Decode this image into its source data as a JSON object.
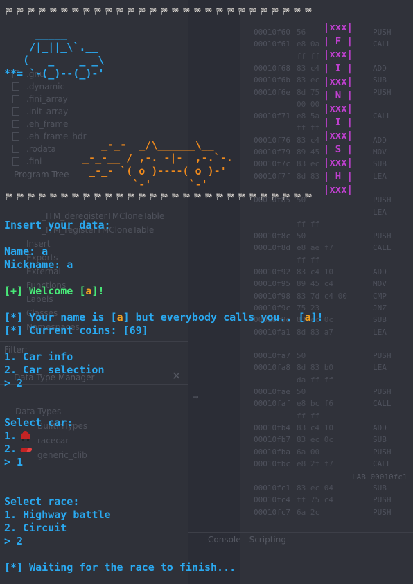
{
  "terminal": {
    "flag_glyph": "🏁",
    "flag_count": 28,
    "car_art_top": "     _____\n    /|_||_\\`.__\n   (   _    _ _\\\n**= `-(_)--(_)-'",
    "car_art_race": "    _-_-  _/\\______\\__\n _-_-__ / ,-. -|-  ,-.`-.\n  _-_- `( o )----( o )-'\n         `-'      `-'",
    "finish_banner": [
      "|xxx|",
      "| F |",
      "|xxx|",
      "| I |",
      "|xxx|",
      "| N |",
      "|xxx|",
      "| I |",
      "|xxx|",
      "| S |",
      "|xxx|",
      "| H |",
      "|xxx|"
    ],
    "insert_prompt": "Insert your data:",
    "name_line": "Name: a",
    "nickname_line": "Nickname: a",
    "welcome": {
      "prefix": "[+] Welcome [",
      "name": "a",
      "suffix": "]!"
    },
    "name_info": {
      "prefix": "[*] Your name is [",
      "name": "a",
      "middle": "] but everybody calls you.. [",
      "nick": "a",
      "suffix": "]!"
    },
    "coins_line": "[*] Current coins: [69]",
    "menu": [
      "1. Car info",
      "2. Car selection"
    ],
    "menu_choice": "> 2",
    "select_car_title": "Select car:",
    "car_options": [
      "1.",
      "2."
    ],
    "car_choice": "> 1",
    "select_race_title": "Select race:",
    "race_options": [
      "1. Highway battle",
      "2. Circuit"
    ],
    "race_choice": "> 2",
    "waiting_line": "[*] Waiting for the race to finish..."
  },
  "background": {
    "tree_items": [
      ".gnu",
      ".dynamic",
      ".fini_array",
      ".init_array",
      ".eh_frame",
      ".eh_frame_hdr",
      ".rodata",
      ".fini"
    ],
    "panel_program_tree": "Program Tree",
    "symbol_items": [
      "_ITM_deregisterTMCloneTable",
      "_ITM_registerTMCloneTable",
      "Insert",
      "Exports",
      "External",
      "Functions",
      "Labels",
      "Classes",
      "Namespaces"
    ],
    "panel_filter": "Filter:",
    "panel_data_type": "Data Type Manager",
    "data_types": [
      "Data Types",
      "BuiltInTypes",
      "racecar",
      "generic_clib"
    ],
    "console_label": "Console - Scripting",
    "lab_label": "LAB_00010fc1",
    "listing": [
      {
        "addr": "00010f60",
        "bytes": "56",
        "mn": "PUSH"
      },
      {
        "addr": "00010f61",
        "bytes": "e8 0a",
        "mn": "CALL"
      },
      {
        "addr": "",
        "bytes": "ff ff",
        "mn": ""
      },
      {
        "addr": "00010f68",
        "bytes": "83 c4",
        "mn": "ADD"
      },
      {
        "addr": "00010f6b",
        "bytes": "83 ec",
        "mn": "SUB"
      },
      {
        "addr": "00010f6e",
        "bytes": "8d 75",
        "mn": "PUSH"
      },
      {
        "addr": "",
        "bytes": "00 00",
        "mn": ""
      },
      {
        "addr": "00010f71",
        "bytes": "e8 5a",
        "mn": "CALL"
      },
      {
        "addr": "",
        "bytes": "ff ff",
        "mn": ""
      },
      {
        "addr": "00010f76",
        "bytes": "83 c4",
        "mn": "ADD"
      },
      {
        "addr": "00010f79",
        "bytes": "89 45",
        "mn": "MOV"
      },
      {
        "addr": "00010f7c",
        "bytes": "83 ec",
        "mn": "SUB"
      },
      {
        "addr": "00010f7f",
        "bytes": "8d 83",
        "mn": "LEA"
      },
      {
        "addr": "",
        "bytes": "",
        "mn": ""
      },
      {
        "addr": "00010f85",
        "bytes": "50",
        "mn": "PUSH"
      },
      {
        "addr": "",
        "bytes": "",
        "mn": "LEA"
      },
      {
        "addr": "",
        "bytes": "ff ff",
        "mn": ""
      },
      {
        "addr": "00010f8c",
        "bytes": "50",
        "mn": "PUSH"
      },
      {
        "addr": "00010f8d",
        "bytes": "e8 ae f7",
        "mn": "CALL"
      },
      {
        "addr": "",
        "bytes": "ff ff",
        "mn": ""
      },
      {
        "addr": "00010f92",
        "bytes": "83 c4 10",
        "mn": "ADD"
      },
      {
        "addr": "00010f95",
        "bytes": "89 45 c4",
        "mn": "MOV"
      },
      {
        "addr": "00010f98",
        "bytes": "83 7d c4 00",
        "mn": "CMP"
      },
      {
        "addr": "00010f9c",
        "bytes": "75 23",
        "mn": "JNZ"
      },
      {
        "addr": "00010f9e",
        "bytes": "83 ec 0c",
        "mn": "SUB"
      },
      {
        "addr": "00010fa1",
        "bytes": "8d 83 a7",
        "mn": "LEA"
      },
      {
        "addr": "",
        "bytes": "",
        "mn": ""
      },
      {
        "addr": "00010fa7",
        "bytes": "50",
        "mn": "PUSH"
      },
      {
        "addr": "00010fa8",
        "bytes": "8d 83 b0",
        "mn": "LEA"
      },
      {
        "addr": "",
        "bytes": "da ff ff",
        "mn": ""
      },
      {
        "addr": "00010fae",
        "bytes": "50",
        "mn": "PUSH"
      },
      {
        "addr": "00010faf",
        "bytes": "e8 bc f6",
        "mn": "CALL"
      },
      {
        "addr": "",
        "bytes": "ff ff",
        "mn": ""
      },
      {
        "addr": "00010fb4",
        "bytes": "83 c4 10",
        "mn": "ADD"
      },
      {
        "addr": "00010fb7",
        "bytes": "83 ec 0c",
        "mn": "SUB"
      },
      {
        "addr": "00010fba",
        "bytes": "6a 00",
        "mn": "PUSH"
      },
      {
        "addr": "00010fbc",
        "bytes": "e8 2f f7",
        "mn": "CALL"
      }
    ],
    "listing_bottom": [
      {
        "addr": "00010fc1",
        "bytes": "83 ec 04",
        "mn": "SUB"
      },
      {
        "addr": "00010fc4",
        "bytes": "ff 75 c4",
        "mn": "PUSH"
      },
      {
        "addr": "00010fc7",
        "bytes": "6a 2c",
        "mn": "PUSH"
      }
    ]
  }
}
